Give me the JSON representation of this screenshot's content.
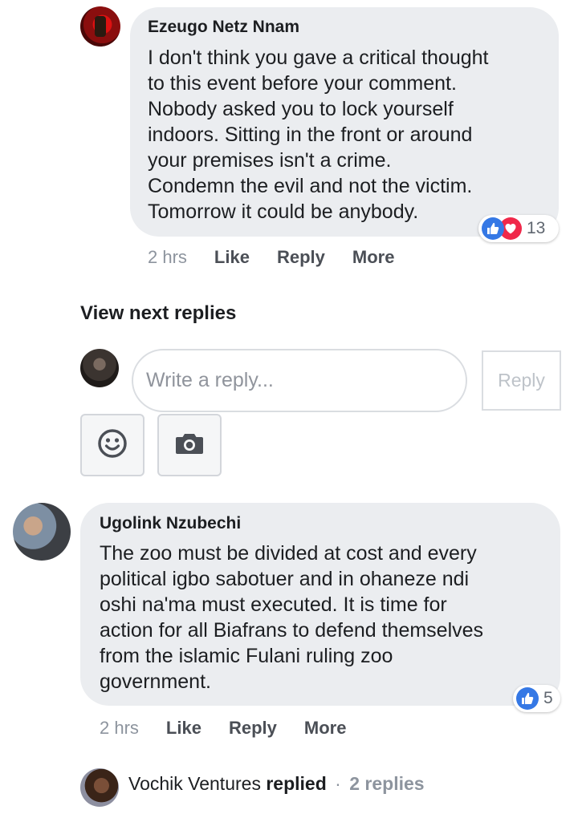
{
  "comment1": {
    "author": "Ezeugo Netz Nnam",
    "text": "I don't think you gave a critical thought\nto this event before your comment.\nNobody asked you to lock yourself\nindoors. Sitting in the front or around\nyour premises isn't a crime.\nCondemn the evil and not the victim.\nTomorrow it could be anybody.",
    "reaction_count": "13",
    "reactions": [
      "like-icon",
      "love-icon"
    ],
    "time": "2 hrs",
    "actions": {
      "like": "Like",
      "reply": "Reply",
      "more": "More"
    }
  },
  "view_next_replies": "View next replies",
  "reply_box": {
    "placeholder": "Write a reply...",
    "button": "Reply",
    "tools": [
      "emoji-icon",
      "camera-icon"
    ]
  },
  "comment2": {
    "author": "Ugolink Nzubechi",
    "text": "The zoo must be divided at cost and every\npolitical igbo sabotuer and in ohaneze ndi\noshi na'ma must executed. It is time for\naction for all Biafrans to defend themselves\nfrom the islamic Fulani ruling zoo\ngovernment.",
    "reaction_count": "5",
    "reactions": [
      "like-icon"
    ],
    "time": "2 hrs",
    "actions": {
      "like": "Like",
      "reply": "Reply",
      "more": "More"
    }
  },
  "replies_summary": {
    "name": "Vochik Ventures",
    "verb": "replied",
    "separator": "·",
    "count": "2 replies"
  },
  "colors": {
    "like_blue": "#3578e5",
    "love_red": "#f0284a",
    "bubble_bg": "#ebedf0",
    "icon_dark": "#4b4f56"
  }
}
